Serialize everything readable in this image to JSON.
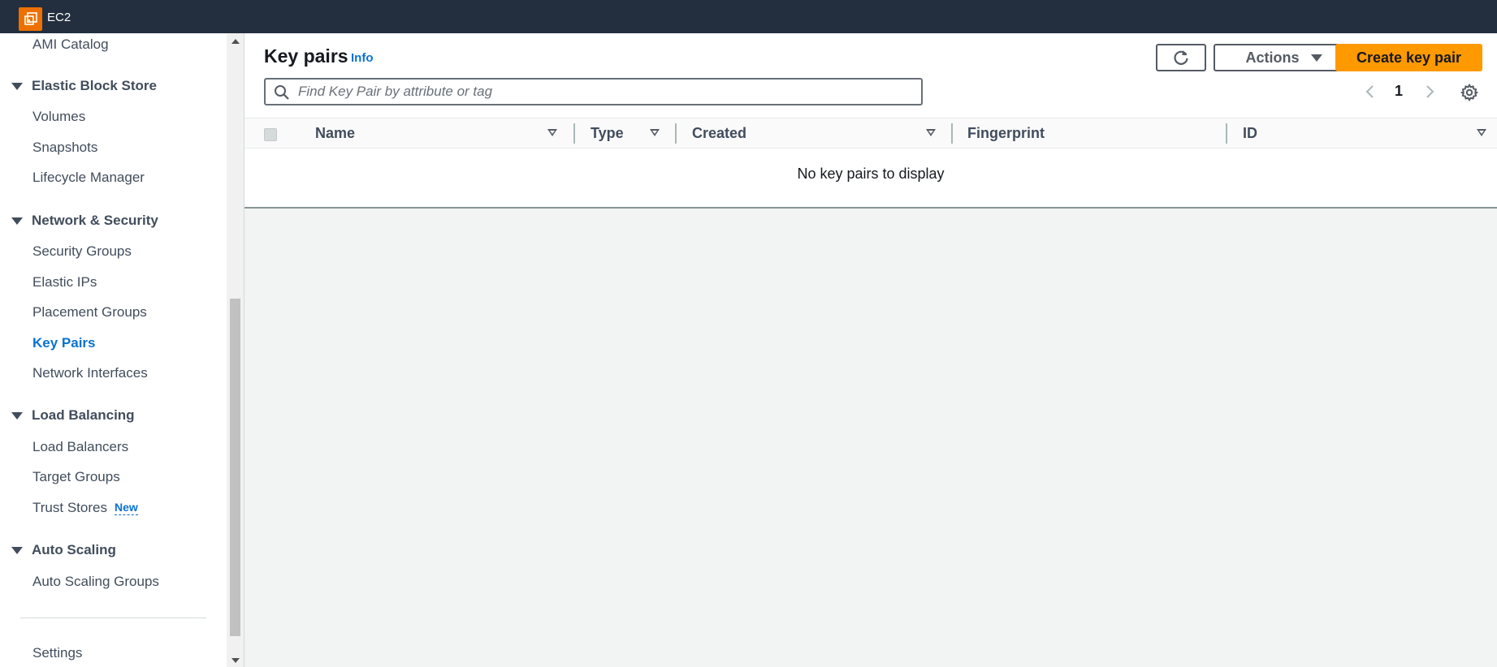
{
  "topbar": {
    "title": "EC2",
    "logo_icon": "ec2-service-icon"
  },
  "sidebar": {
    "items": [
      {
        "label": "AMI Catalog"
      },
      {
        "section": "Elastic Block Store"
      },
      {
        "label": "Volumes"
      },
      {
        "label": "Snapshots"
      },
      {
        "label": "Lifecycle Manager"
      },
      {
        "section": "Network & Security"
      },
      {
        "label": "Security Groups"
      },
      {
        "label": "Elastic IPs"
      },
      {
        "label": "Placement Groups"
      },
      {
        "label": "Key Pairs",
        "active": true
      },
      {
        "label": "Network Interfaces"
      },
      {
        "section": "Load Balancing"
      },
      {
        "label": "Load Balancers"
      },
      {
        "label": "Target Groups"
      },
      {
        "label": "Trust Stores",
        "badge": "New"
      },
      {
        "section": "Auto Scaling"
      },
      {
        "label": "Auto Scaling Groups"
      },
      {
        "label": "Settings"
      }
    ]
  },
  "main": {
    "title": "Key pairs",
    "info_link": "Info",
    "actions_label": "Actions",
    "create_label": "Create key pair",
    "search_placeholder": "Find Key Pair by attribute or tag",
    "page_number": "1",
    "columns": [
      "Name",
      "Type",
      "Created",
      "Fingerprint",
      "ID"
    ],
    "empty_message": "No key pairs to display"
  },
  "colors": {
    "topbar_bg": "#232f3e",
    "primary_button": "#ff9900",
    "link": "#0972d3",
    "logo": "#ed7100"
  }
}
